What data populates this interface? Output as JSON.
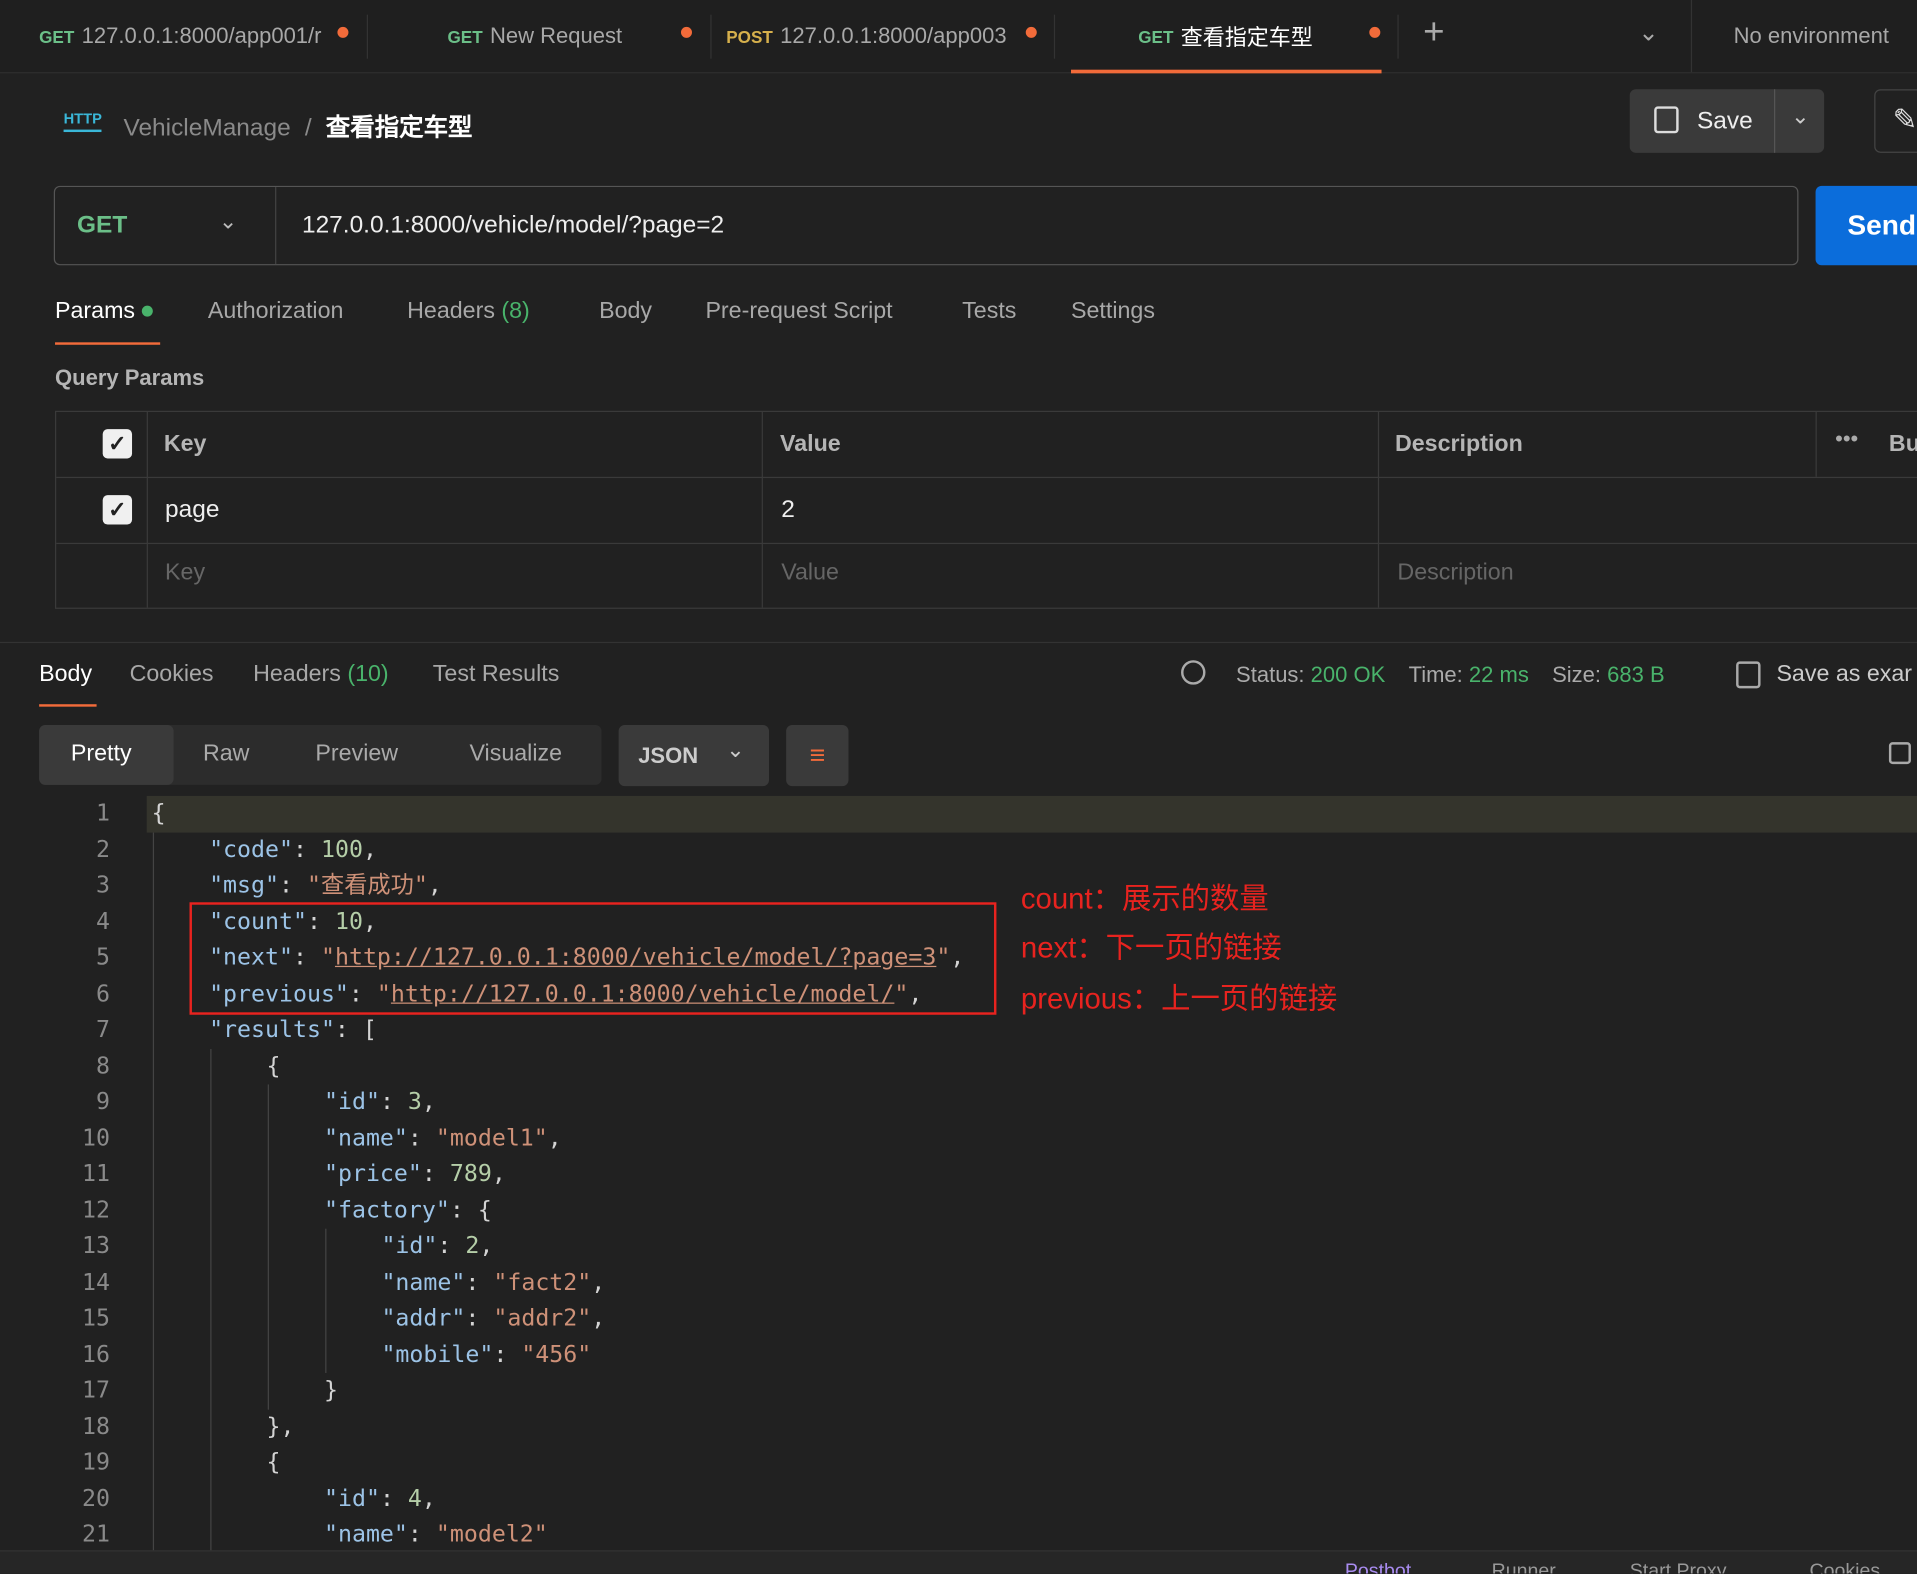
{
  "tabs": [
    {
      "method": "GET",
      "label": "127.0.0.1:8000/app001/r",
      "method_color": "#6bbf88"
    },
    {
      "method": "GET",
      "label": "New Request",
      "method_color": "#6bbf88"
    },
    {
      "method": "POST",
      "label": "127.0.0.1:8000/app003",
      "method_color": "#d6b04c"
    },
    {
      "method": "GET",
      "label": "查看指定车型",
      "method_color": "#6bbf88"
    }
  ],
  "environment": "No environment",
  "breadcrumb": {
    "icon_text": "HTTP",
    "collection": "VehicleManage",
    "separator": "/",
    "request": "查看指定车型"
  },
  "save_label": "Save",
  "method": "GET",
  "url": "127.0.0.1:8000/vehicle/model/?page=2",
  "send_label": "Send",
  "request_tabs": [
    "Params",
    "Authorization",
    "Headers",
    "(8)",
    "Body",
    "Pre-request Script",
    "Tests",
    "Settings"
  ],
  "query_params": {
    "title": "Query Params",
    "headers": [
      "Key",
      "Value",
      "Description",
      "Bu"
    ],
    "rows": [
      {
        "key": "page",
        "value": "2",
        "checked": true
      }
    ],
    "placeholder": {
      "key": "Key",
      "value": "Value",
      "description": "Description"
    }
  },
  "response": {
    "tabs": [
      "Body",
      "Cookies",
      "Headers",
      "(10)",
      "Test Results"
    ],
    "status_label": "Status:",
    "status": "200 OK",
    "time_label": "Time:",
    "time": "22 ms",
    "size_label": "Size:",
    "size": "683 B",
    "save_example": "Save as exar",
    "views": [
      "Pretty",
      "Raw",
      "Preview",
      "Visualize"
    ],
    "format": "JSON"
  },
  "code_lines": [
    {
      "i": 0,
      "t": [
        [
          "{",
          "p"
        ]
      ]
    },
    {
      "i": 1,
      "t": [
        [
          "\"code\"",
          "k"
        ],
        [
          ": ",
          "p"
        ],
        [
          "100",
          "n"
        ],
        [
          ",",
          "p"
        ]
      ]
    },
    {
      "i": 1,
      "t": [
        [
          "\"msg\"",
          "k"
        ],
        [
          ": ",
          "p"
        ],
        [
          "\"查看成功\"",
          "s"
        ],
        [
          ",",
          "p"
        ]
      ]
    },
    {
      "i": 1,
      "t": [
        [
          "\"count\"",
          "k"
        ],
        [
          ": ",
          "p"
        ],
        [
          "10",
          "n"
        ],
        [
          ",",
          "p"
        ]
      ]
    },
    {
      "i": 1,
      "t": [
        [
          "\"next\"",
          "k"
        ],
        [
          ": ",
          "p"
        ],
        [
          "\"",
          "s"
        ],
        [
          "http://127.0.0.1:8000/vehicle/model/?page=3",
          "u"
        ],
        [
          "\"",
          "s"
        ],
        [
          ",",
          "p"
        ]
      ]
    },
    {
      "i": 1,
      "t": [
        [
          "\"previous\"",
          "k"
        ],
        [
          ": ",
          "p"
        ],
        [
          "\"",
          "s"
        ],
        [
          "http://127.0.0.1:8000/vehicle/model/",
          "u"
        ],
        [
          "\"",
          "s"
        ],
        [
          ",",
          "p"
        ]
      ]
    },
    {
      "i": 1,
      "t": [
        [
          "\"results\"",
          "k"
        ],
        [
          ": [",
          "p"
        ]
      ]
    },
    {
      "i": 2,
      "t": [
        [
          "{",
          "p"
        ]
      ]
    },
    {
      "i": 3,
      "t": [
        [
          "\"id\"",
          "k"
        ],
        [
          ": ",
          "p"
        ],
        [
          "3",
          "n"
        ],
        [
          ",",
          "p"
        ]
      ]
    },
    {
      "i": 3,
      "t": [
        [
          "\"name\"",
          "k"
        ],
        [
          ": ",
          "p"
        ],
        [
          "\"model1\"",
          "s"
        ],
        [
          ",",
          "p"
        ]
      ]
    },
    {
      "i": 3,
      "t": [
        [
          "\"price\"",
          "k"
        ],
        [
          ": ",
          "p"
        ],
        [
          "789",
          "n"
        ],
        [
          ",",
          "p"
        ]
      ]
    },
    {
      "i": 3,
      "t": [
        [
          "\"factory\"",
          "k"
        ],
        [
          ": {",
          "p"
        ]
      ]
    },
    {
      "i": 4,
      "t": [
        [
          "\"id\"",
          "k"
        ],
        [
          ": ",
          "p"
        ],
        [
          "2",
          "n"
        ],
        [
          ",",
          "p"
        ]
      ]
    },
    {
      "i": 4,
      "t": [
        [
          "\"name\"",
          "k"
        ],
        [
          ": ",
          "p"
        ],
        [
          "\"fact2\"",
          "s"
        ],
        [
          ",",
          "p"
        ]
      ]
    },
    {
      "i": 4,
      "t": [
        [
          "\"addr\"",
          "k"
        ],
        [
          ": ",
          "p"
        ],
        [
          "\"addr2\"",
          "s"
        ],
        [
          ",",
          "p"
        ]
      ]
    },
    {
      "i": 4,
      "t": [
        [
          "\"mobile\"",
          "k"
        ],
        [
          ": ",
          "p"
        ],
        [
          "\"456\"",
          "s"
        ]
      ]
    },
    {
      "i": 3,
      "t": [
        [
          "}",
          "p"
        ]
      ]
    },
    {
      "i": 2,
      "t": [
        [
          "},",
          "p"
        ]
      ]
    },
    {
      "i": 2,
      "t": [
        [
          "{",
          "p"
        ]
      ]
    },
    {
      "i": 3,
      "t": [
        [
          "\"id\"",
          "k"
        ],
        [
          ": ",
          "p"
        ],
        [
          "4",
          "n"
        ],
        [
          ",",
          "p"
        ]
      ]
    },
    {
      "i": 3,
      "t": [
        [
          "\"name\"",
          "k"
        ],
        [
          ": ",
          "p"
        ],
        [
          "\"model2\"",
          "s"
        ]
      ]
    }
  ],
  "annotations": [
    "count：展示的数量",
    "next：下一页的链接",
    "previous：上一页的链接"
  ],
  "statusbar": [
    "Postbot",
    "Runner",
    "Start Proxy",
    "Cookies"
  ]
}
